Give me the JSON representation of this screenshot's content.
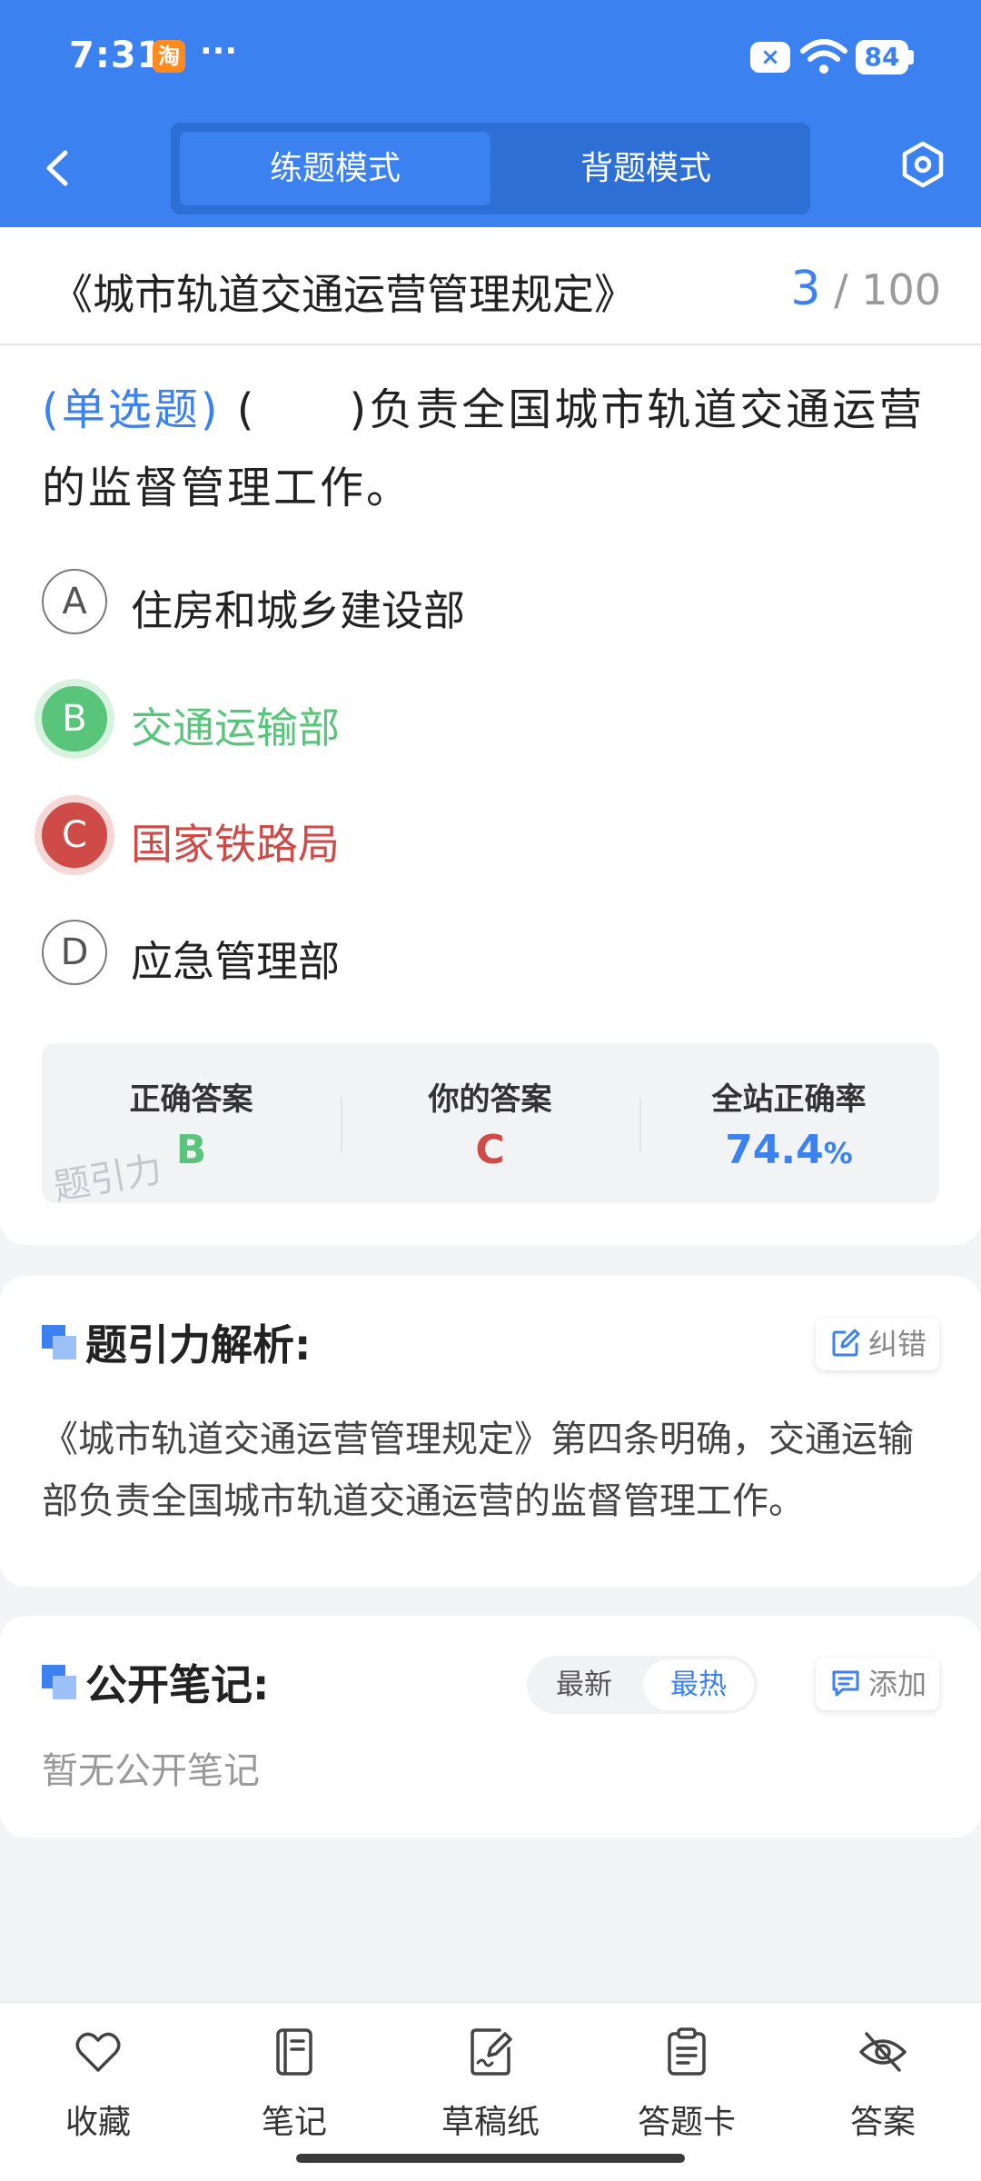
{
  "status_bar": {
    "time": "7:31",
    "app_badge": "淘",
    "dots": "···",
    "notification": "×",
    "battery": "84"
  },
  "nav": {
    "modes": [
      "练题模式",
      "背题模式"
    ],
    "active_mode": "练题模式"
  },
  "title_row": {
    "title": "《城市轨道交通运营管理规定》",
    "current": "3",
    "separator": "/",
    "total": "100"
  },
  "question": {
    "type": "(单选题)",
    "stem": "(　　)负责全国城市轨道交通运营的监督管理工作。",
    "options": [
      {
        "letter": "A",
        "text": "住房和城乡建设部",
        "state": "normal"
      },
      {
        "letter": "B",
        "text": "交通运输部",
        "state": "correct"
      },
      {
        "letter": "C",
        "text": "国家铁路局",
        "state": "wrong"
      },
      {
        "letter": "D",
        "text": "应急管理部",
        "state": "normal"
      }
    ]
  },
  "answer_box": {
    "correct_label": "正确答案",
    "correct_value": "B",
    "yours_label": "你的答案",
    "yours_value": "C",
    "rate_label": "全站正确率",
    "rate_value": "74.4",
    "rate_unit": "%",
    "watermark": "题引力"
  },
  "analysis": {
    "title": "题引力解析:",
    "report_button": "纠错",
    "text": "《城市轨道交通运营管理规定》第四条明确，交通运输部负责全国城市轨道交通运营的监督管理工作。"
  },
  "notes": {
    "title": "公开笔记:",
    "sort_options": [
      "最新",
      "最热"
    ],
    "active_sort": "最热",
    "add_button": "添加",
    "empty_text": "暂无公开笔记"
  },
  "bottom_bar": {
    "items": [
      {
        "label": "收藏",
        "icon": "heart-icon"
      },
      {
        "label": "笔记",
        "icon": "notebook-icon"
      },
      {
        "label": "草稿纸",
        "icon": "draft-paper-icon"
      },
      {
        "label": "答题卡",
        "icon": "answer-card-icon"
      },
      {
        "label": "答案",
        "icon": "eye-off-icon"
      }
    ]
  },
  "colors": {
    "primary": "#3b82f0",
    "correct": "#58c57b",
    "wrong": "#cf4b47"
  }
}
